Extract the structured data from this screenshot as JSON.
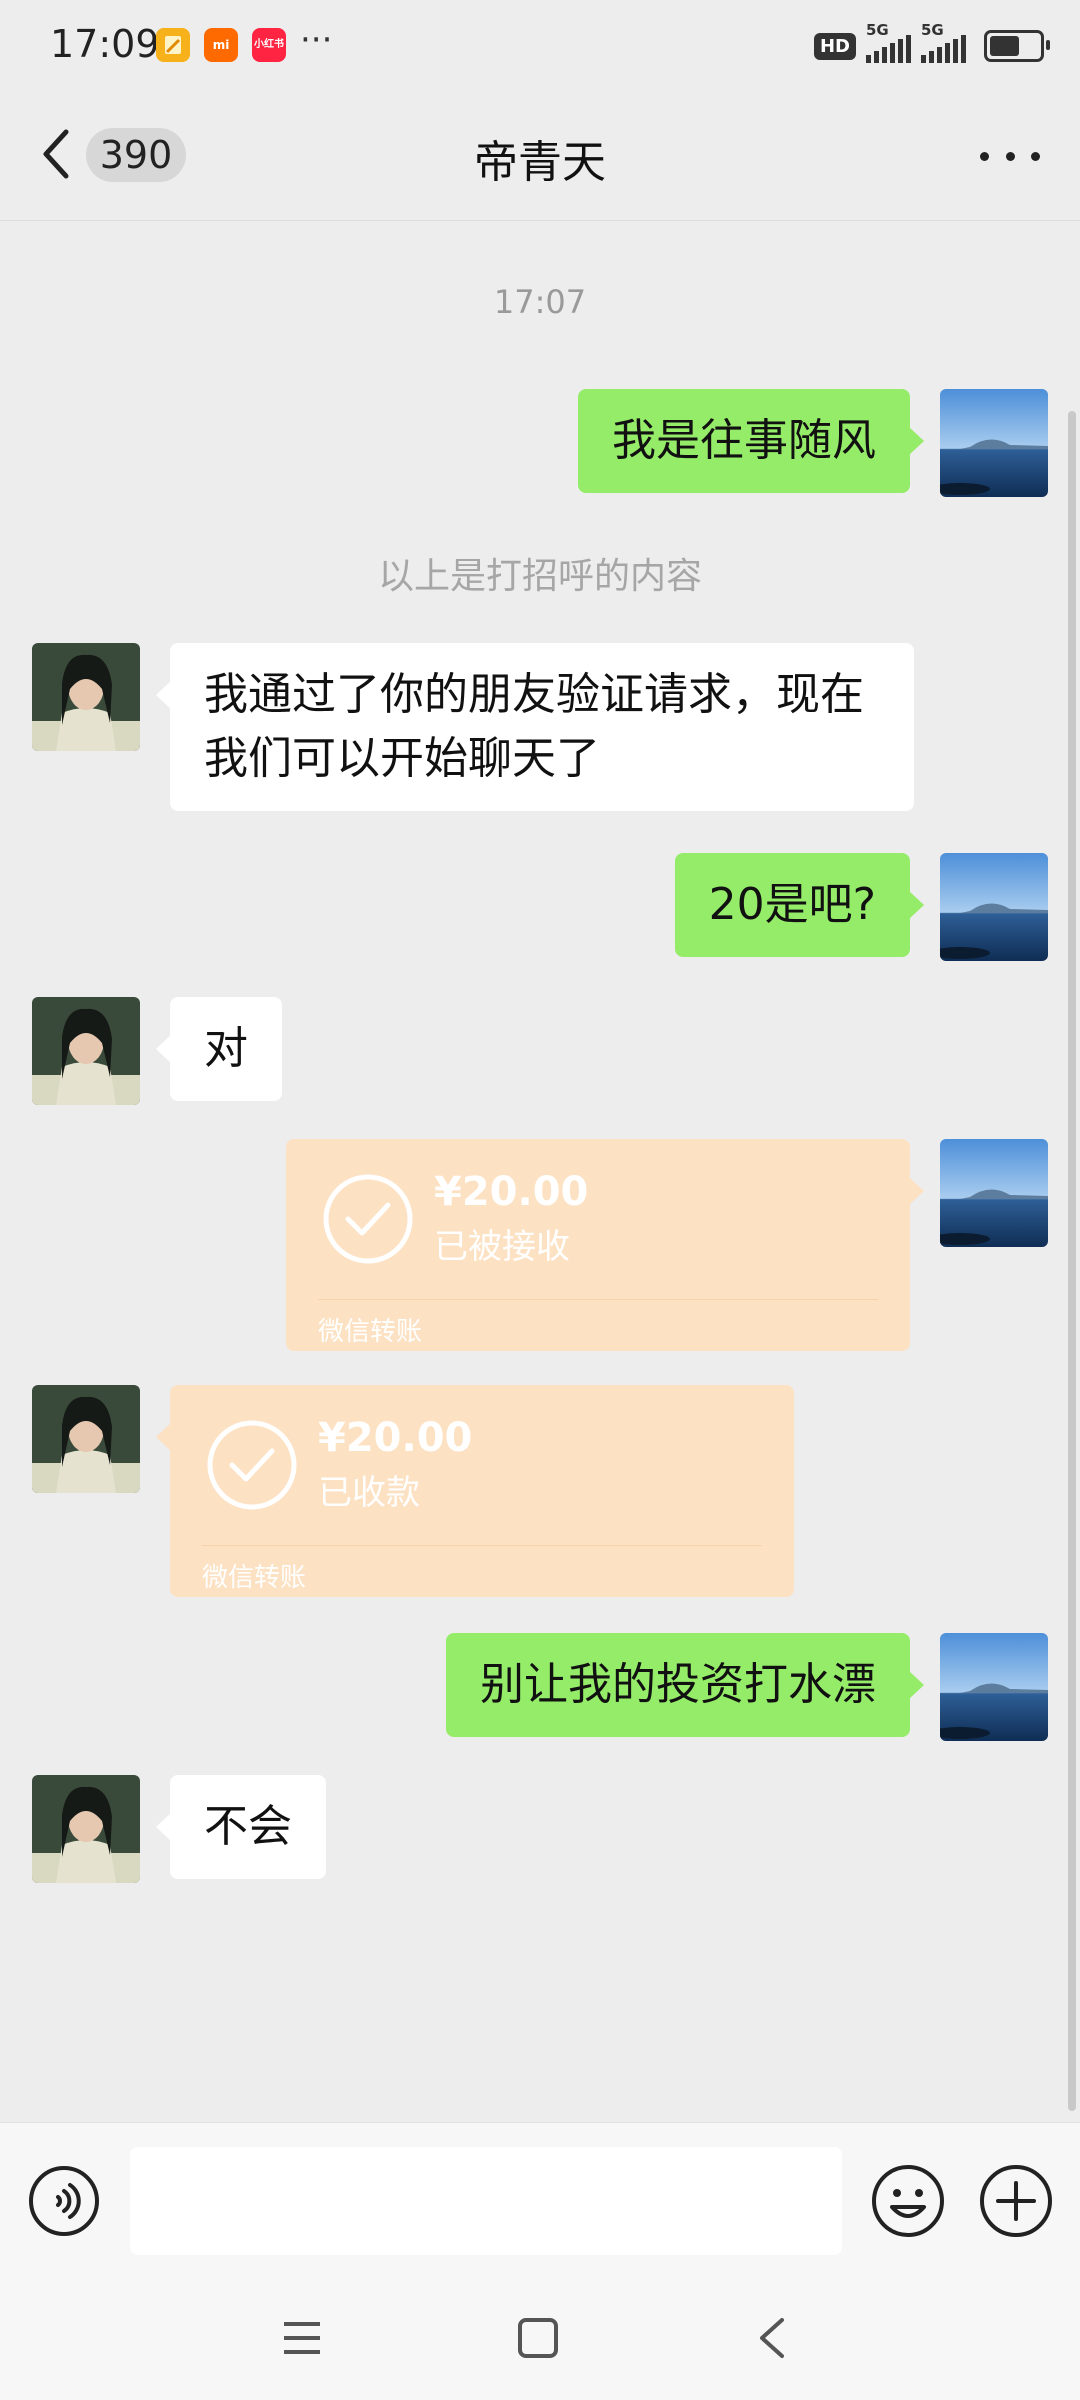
{
  "status_bar": {
    "time": "17:09",
    "more_indicator": "···",
    "hd_label": "HD",
    "network_1": "5G",
    "network_2": "5G",
    "battery_level": 0.6,
    "notification_icons": [
      "notes-icon",
      "mi-icon",
      "xiaohongshu-icon"
    ],
    "app_icon_labels": [
      "",
      "mi",
      "小红书"
    ]
  },
  "header": {
    "back_icon": "chevron-left-icon",
    "unread_count": "390",
    "title": "帝青天",
    "more_icon": "more-dots-icon"
  },
  "chat": {
    "timestamp": "17:07",
    "system_note": "以上是打招呼的内容",
    "messages": [
      {
        "side": "right",
        "type": "text",
        "text": "我是往事随风"
      },
      {
        "side": "left",
        "type": "text",
        "text": "我通过了你的朋友验证请求，现在我们可以开始聊天了"
      },
      {
        "side": "right",
        "type": "text",
        "text": "20是吧?"
      },
      {
        "side": "left",
        "type": "text",
        "text": "对"
      },
      {
        "side": "right",
        "type": "transfer",
        "amount": "¥20.00",
        "status": "已被接收",
        "footer": "微信转账"
      },
      {
        "side": "left",
        "type": "transfer",
        "amount": "¥20.00",
        "status": "已收款",
        "footer": "微信转账"
      },
      {
        "side": "right",
        "type": "text",
        "text": "别让我的投资打水漂"
      },
      {
        "side": "left",
        "type": "text",
        "text": "不会"
      }
    ]
  },
  "input_bar": {
    "voice_icon": "voice-icon",
    "input_value": "",
    "emoji_icon": "emoji-icon",
    "plus_icon": "plus-icon"
  },
  "nav_bar": {
    "menu_icon": "menu-icon",
    "home_icon": "home-icon",
    "back_icon": "back-icon"
  },
  "colors": {
    "background": "#ededed",
    "sent_bubble": "#95ec69",
    "received_bubble": "#ffffff",
    "transfer_bubble": "#fde1c3"
  }
}
